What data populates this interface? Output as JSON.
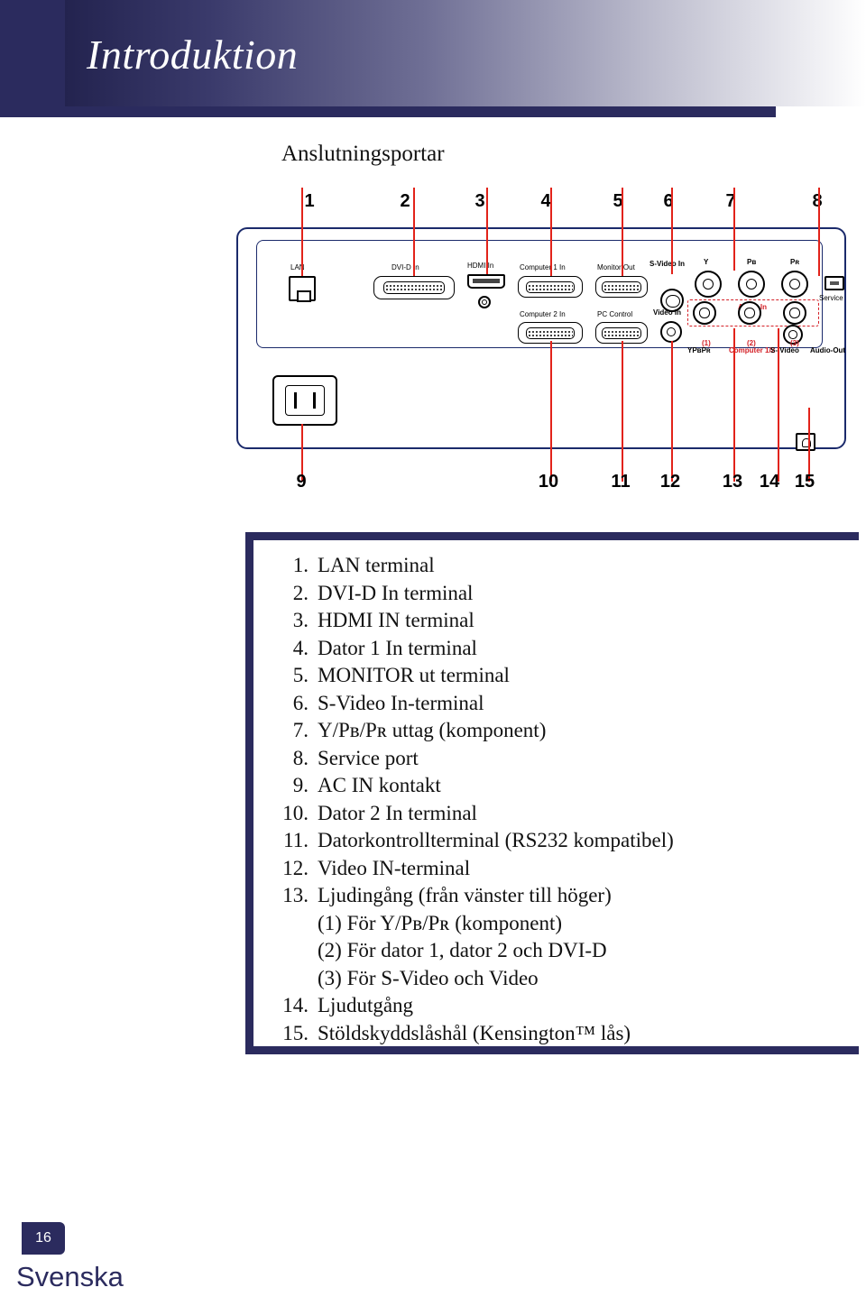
{
  "header": {
    "title": "Introduktion"
  },
  "section": {
    "heading": "Anslutningsportar"
  },
  "callouts_top": [
    "1",
    "2",
    "3",
    "4",
    "5",
    "6",
    "7",
    "8"
  ],
  "callouts_bottom": [
    "9",
    "10",
    "11",
    "12",
    "13",
    "14",
    "15"
  ],
  "panel_labels": {
    "lan": "LAN",
    "dvid_in": "DVI-D In",
    "hdmi_in": "HDMI In",
    "computer1_in": "Computer 1 In",
    "computer2_in": "Computer 2 In",
    "monitor_out": "Monitor Out",
    "pc_control": "PC Control",
    "svideo_in": "S-Video In",
    "video_in": "Video In",
    "y": "Y",
    "pb": "Pв",
    "pr": "Pʀ",
    "ypbpr": "YPвPʀ",
    "audio_in": "Audio In",
    "computer_1_2": "Computer 1/2",
    "svideo_video": "S-/Video",
    "audio_out": "Audio-Out",
    "service": "Service",
    "in_1": "(1)",
    "in_2": "(2)",
    "in_3": "(3)"
  },
  "list": {
    "items": [
      {
        "num": "1.",
        "text": "LAN terminal"
      },
      {
        "num": "2.",
        "text": "DVI-D In terminal"
      },
      {
        "num": "3.",
        "text": "HDMI IN terminal"
      },
      {
        "num": "4.",
        "text": "Dator 1 In terminal"
      },
      {
        "num": "5.",
        "text": "MONITOR ut terminal"
      },
      {
        "num": "6.",
        "text": "S-Video In-terminal"
      },
      {
        "num": "7.",
        "text": "Y/Pв/Pʀ uttag (komponent)",
        "html": true
      },
      {
        "num": "8.",
        "text": "Service port"
      },
      {
        "num": "9.",
        "text": "AC IN kontakt"
      },
      {
        "num": "10.",
        "text": "Dator 2 In terminal"
      },
      {
        "num": "11.",
        "text": "Datorkontrollterminal (RS232 kompatibel)"
      },
      {
        "num": "12.",
        "text": "Video IN-terminal"
      },
      {
        "num": "13.",
        "text": "Ljudingång (från vänster till höger)"
      },
      {
        "num": "14.",
        "text": "Ljudutgång"
      },
      {
        "num": "15.",
        "text": "Stöldskyddslåshål (Kensington™ lås)"
      }
    ],
    "sub_items": [
      "(1) För Y/Pв/Pʀ (komponent)",
      "(2) För dator 1, dator 2 och DVI-D",
      "(3) För S-Video och Video"
    ]
  },
  "footer": {
    "page_number": "16",
    "language": "Svenska"
  },
  "colors": {
    "navy": "#2b2b5e",
    "red": "#e2231a",
    "panel_outline": "#1b2a6b"
  }
}
